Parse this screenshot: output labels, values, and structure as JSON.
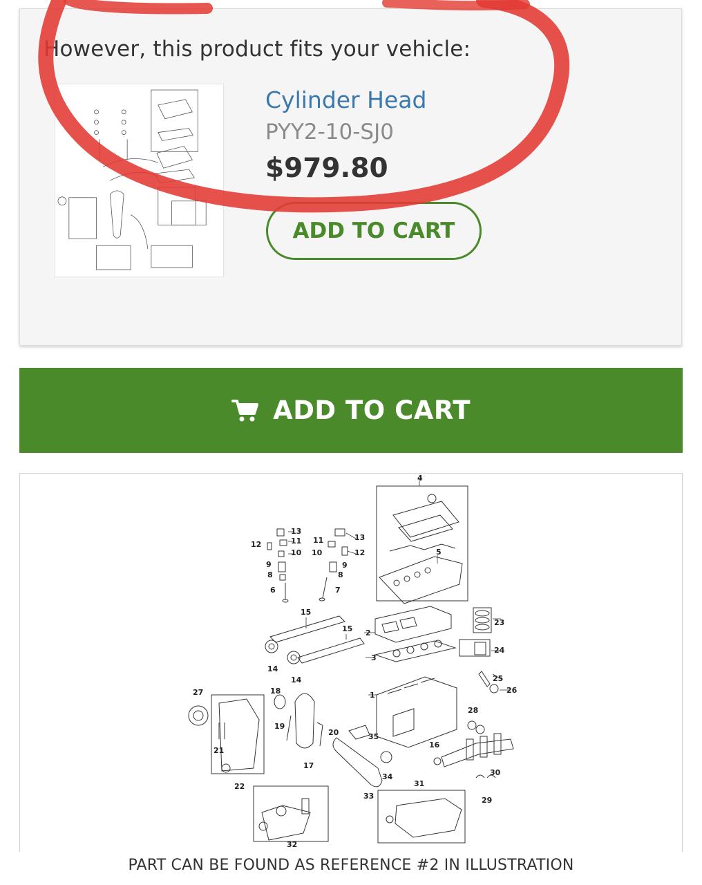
{
  "fits_card": {
    "heading": "However, this product fits your vehicle:",
    "product_name": "Cylinder Head",
    "part_number": "PYY2-10-SJ0",
    "price": "$979.80",
    "add_to_cart_label": "ADD TO CART"
  },
  "main_action": {
    "add_to_cart_label": "ADD TO CART",
    "icon": "shopping-cart-icon"
  },
  "diagram": {
    "callouts": [
      "1",
      "2",
      "3",
      "4",
      "5",
      "6",
      "7",
      "8",
      "9",
      "10",
      "11",
      "12",
      "13",
      "14",
      "15",
      "16",
      "17",
      "18",
      "19",
      "20",
      "21",
      "22",
      "23",
      "24",
      "25",
      "26",
      "27",
      "28",
      "29",
      "30",
      "31",
      "32",
      "33",
      "34",
      "35"
    ]
  },
  "footer_note": "PART CAN BE FOUND AS REFERENCE #2 IN ILLUSTRATION",
  "colors": {
    "brand_green": "#4a8a2a",
    "link_blue": "#3a78ad",
    "annotation_red": "#e23a32",
    "card_bg": "#f5f5f5"
  }
}
